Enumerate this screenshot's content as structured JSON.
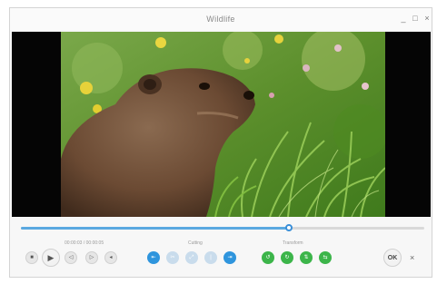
{
  "window": {
    "title": "Wildlife",
    "minimize_glyph": "_",
    "maximize_glyph": "□",
    "close_glyph": "×"
  },
  "video": {
    "subject": "marmot in grassy meadow",
    "colors": {
      "background": "#050505",
      "grass": "#5f9a2f",
      "fur": "#6b4a33"
    }
  },
  "timeline": {
    "progress": 0.665,
    "time_display": "00:00:03 / 00:00:05"
  },
  "transport": {
    "stop_icon": "stop-icon",
    "play_icon": "play-icon",
    "prev_frame_icon": "prev-frame-icon",
    "next_frame_icon": "next-frame-icon",
    "volume_icon": "volume-icon"
  },
  "cutting": {
    "label": "Cutting",
    "buttons": [
      "set-start-icon",
      "cut-icon",
      "trim-icon",
      "split-icon",
      "set-end-icon"
    ]
  },
  "transform": {
    "label": "Transform",
    "buttons": [
      "rotate-left-icon",
      "rotate-right-icon",
      "flip-vertical-icon",
      "flip-horizontal-icon"
    ]
  },
  "actions": {
    "ok_label": "OK",
    "cancel_glyph": "×"
  },
  "colors": {
    "accent_blue": "#2f95dd",
    "accent_green": "#3cb54a"
  }
}
